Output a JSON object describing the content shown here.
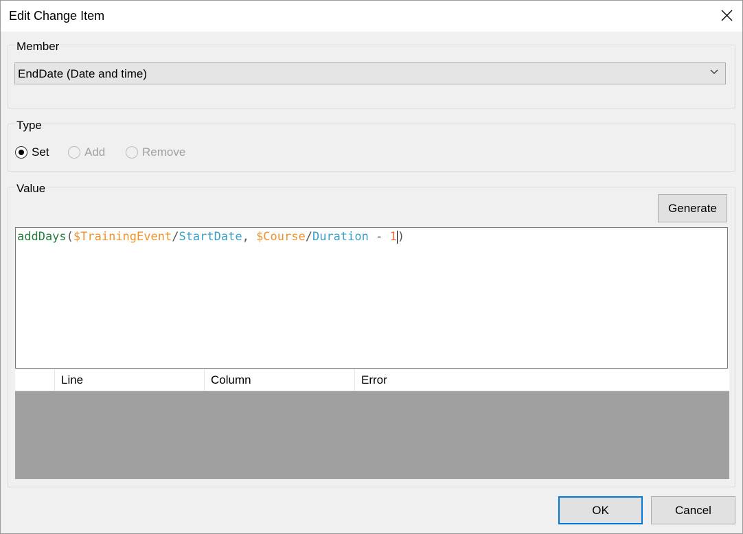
{
  "window": {
    "title": "Edit Change Item"
  },
  "member": {
    "group_label": "Member",
    "selected": "EndDate (Date and time)"
  },
  "type": {
    "group_label": "Type",
    "options": [
      {
        "label": "Set",
        "checked": true,
        "enabled": true
      },
      {
        "label": "Add",
        "checked": false,
        "enabled": false
      },
      {
        "label": "Remove",
        "checked": false,
        "enabled": false
      }
    ]
  },
  "value": {
    "group_label": "Value",
    "generate_label": "Generate",
    "expression": {
      "fn": "addDays",
      "open": "(",
      "var1": "$TrainingEvent",
      "sep1": "/",
      "attr1": "StartDate",
      "comma": ", ",
      "var2": "$Course",
      "sep2": "/",
      "attr2": "Duration",
      "minus": " - ",
      "num": "1",
      "close": ")"
    },
    "error_columns": [
      "",
      "Line",
      "Column",
      "Error"
    ]
  },
  "buttons": {
    "ok": "OK",
    "cancel": "Cancel"
  },
  "colors": {
    "accent": "#0078d7",
    "grid_empty": "#a0a0a0"
  }
}
